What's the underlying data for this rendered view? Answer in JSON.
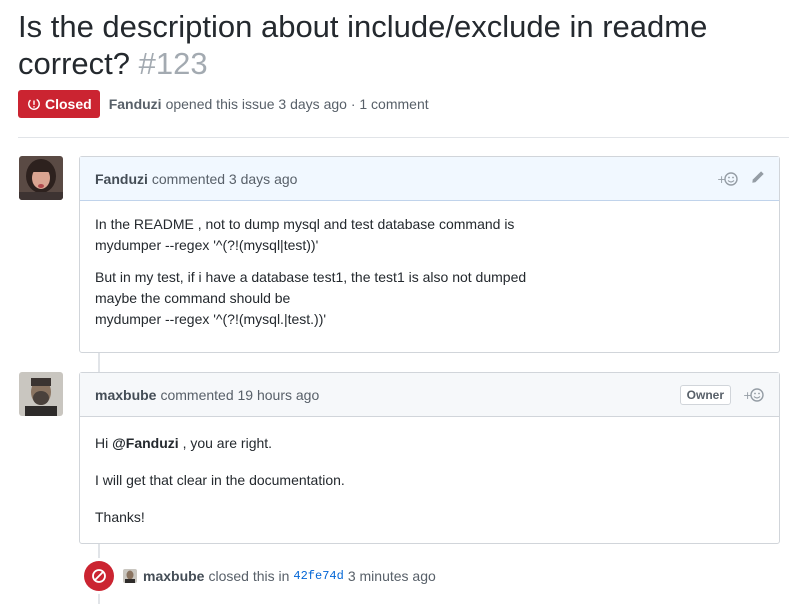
{
  "issue": {
    "title": "Is the description about include/exclude in readme correct?",
    "number": "#123",
    "state_label": "Closed",
    "opened_by": "Fanduzi",
    "opened_text": "opened this issue 3 days ago · 1 comment"
  },
  "comments": [
    {
      "author": "Fanduzi",
      "action_text": "commented 3 days ago",
      "body": [
        [
          "In the README , not to dump mysql and test database command is",
          "mydumper --regex '^(?!(mysql|test))'"
        ],
        [
          "But in my test, if i have a database test1, the test1 is also not dumped",
          "maybe the command should be",
          "mydumper --regex '^(?!(mysql.|test.))'"
        ]
      ]
    },
    {
      "author": "maxbube",
      "action_text": "commented 19 hours ago",
      "role_label": "Owner",
      "body_greeting_prefix": "Hi",
      "body_mention": "@Fanduzi",
      "body_greeting_suffix": ", you are right.",
      "body_line2": "I will get that clear in the documentation.",
      "body_line3": "Thanks!"
    }
  ],
  "close_event": {
    "actor": "maxbube",
    "action_text": "closed this in",
    "commit": "42fe74d",
    "time_text": "3 minutes ago"
  },
  "icons": {
    "state": "issue-closed-icon",
    "reaction": "smiley-add-icon",
    "edit": "pencil-icon",
    "close_event": "circle-slash-icon"
  },
  "colors": {
    "closed_red": "#cb2431",
    "link_blue": "#0366d6",
    "header_blue": "#f1f8ff"
  }
}
